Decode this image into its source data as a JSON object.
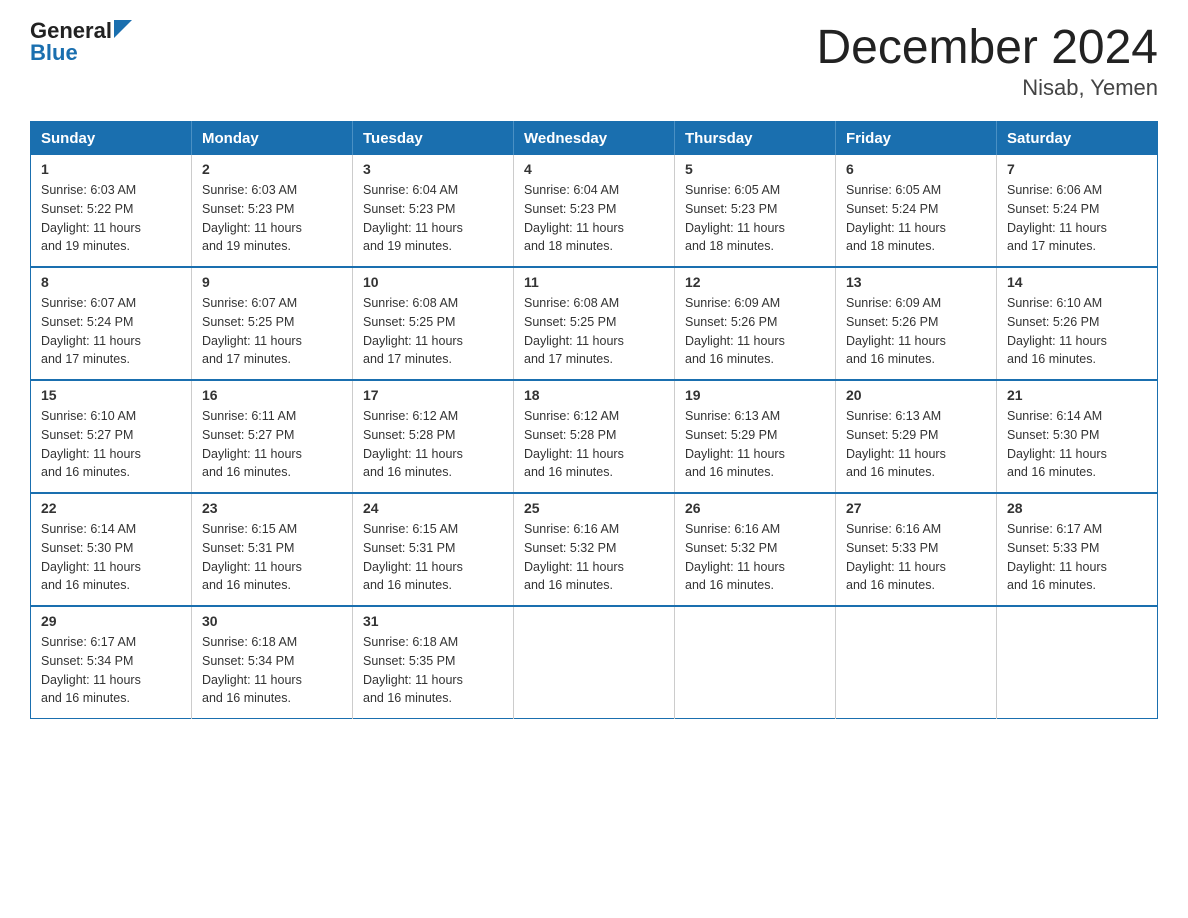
{
  "header": {
    "logo_line1": "General",
    "logo_line2": "Blue",
    "title": "December 2024",
    "subtitle": "Nisab, Yemen"
  },
  "days_of_week": [
    "Sunday",
    "Monday",
    "Tuesday",
    "Wednesday",
    "Thursday",
    "Friday",
    "Saturday"
  ],
  "weeks": [
    [
      {
        "day": "1",
        "sunrise": "6:03 AM",
        "sunset": "5:22 PM",
        "daylight": "11 hours and 19 minutes."
      },
      {
        "day": "2",
        "sunrise": "6:03 AM",
        "sunset": "5:23 PM",
        "daylight": "11 hours and 19 minutes."
      },
      {
        "day": "3",
        "sunrise": "6:04 AM",
        "sunset": "5:23 PM",
        "daylight": "11 hours and 19 minutes."
      },
      {
        "day": "4",
        "sunrise": "6:04 AM",
        "sunset": "5:23 PM",
        "daylight": "11 hours and 18 minutes."
      },
      {
        "day": "5",
        "sunrise": "6:05 AM",
        "sunset": "5:23 PM",
        "daylight": "11 hours and 18 minutes."
      },
      {
        "day": "6",
        "sunrise": "6:05 AM",
        "sunset": "5:24 PM",
        "daylight": "11 hours and 18 minutes."
      },
      {
        "day": "7",
        "sunrise": "6:06 AM",
        "sunset": "5:24 PM",
        "daylight": "11 hours and 17 minutes."
      }
    ],
    [
      {
        "day": "8",
        "sunrise": "6:07 AM",
        "sunset": "5:24 PM",
        "daylight": "11 hours and 17 minutes."
      },
      {
        "day": "9",
        "sunrise": "6:07 AM",
        "sunset": "5:25 PM",
        "daylight": "11 hours and 17 minutes."
      },
      {
        "day": "10",
        "sunrise": "6:08 AM",
        "sunset": "5:25 PM",
        "daylight": "11 hours and 17 minutes."
      },
      {
        "day": "11",
        "sunrise": "6:08 AM",
        "sunset": "5:25 PM",
        "daylight": "11 hours and 17 minutes."
      },
      {
        "day": "12",
        "sunrise": "6:09 AM",
        "sunset": "5:26 PM",
        "daylight": "11 hours and 16 minutes."
      },
      {
        "day": "13",
        "sunrise": "6:09 AM",
        "sunset": "5:26 PM",
        "daylight": "11 hours and 16 minutes."
      },
      {
        "day": "14",
        "sunrise": "6:10 AM",
        "sunset": "5:26 PM",
        "daylight": "11 hours and 16 minutes."
      }
    ],
    [
      {
        "day": "15",
        "sunrise": "6:10 AM",
        "sunset": "5:27 PM",
        "daylight": "11 hours and 16 minutes."
      },
      {
        "day": "16",
        "sunrise": "6:11 AM",
        "sunset": "5:27 PM",
        "daylight": "11 hours and 16 minutes."
      },
      {
        "day": "17",
        "sunrise": "6:12 AM",
        "sunset": "5:28 PM",
        "daylight": "11 hours and 16 minutes."
      },
      {
        "day": "18",
        "sunrise": "6:12 AM",
        "sunset": "5:28 PM",
        "daylight": "11 hours and 16 minutes."
      },
      {
        "day": "19",
        "sunrise": "6:13 AM",
        "sunset": "5:29 PM",
        "daylight": "11 hours and 16 minutes."
      },
      {
        "day": "20",
        "sunrise": "6:13 AM",
        "sunset": "5:29 PM",
        "daylight": "11 hours and 16 minutes."
      },
      {
        "day": "21",
        "sunrise": "6:14 AM",
        "sunset": "5:30 PM",
        "daylight": "11 hours and 16 minutes."
      }
    ],
    [
      {
        "day": "22",
        "sunrise": "6:14 AM",
        "sunset": "5:30 PM",
        "daylight": "11 hours and 16 minutes."
      },
      {
        "day": "23",
        "sunrise": "6:15 AM",
        "sunset": "5:31 PM",
        "daylight": "11 hours and 16 minutes."
      },
      {
        "day": "24",
        "sunrise": "6:15 AM",
        "sunset": "5:31 PM",
        "daylight": "11 hours and 16 minutes."
      },
      {
        "day": "25",
        "sunrise": "6:16 AM",
        "sunset": "5:32 PM",
        "daylight": "11 hours and 16 minutes."
      },
      {
        "day": "26",
        "sunrise": "6:16 AM",
        "sunset": "5:32 PM",
        "daylight": "11 hours and 16 minutes."
      },
      {
        "day": "27",
        "sunrise": "6:16 AM",
        "sunset": "5:33 PM",
        "daylight": "11 hours and 16 minutes."
      },
      {
        "day": "28",
        "sunrise": "6:17 AM",
        "sunset": "5:33 PM",
        "daylight": "11 hours and 16 minutes."
      }
    ],
    [
      {
        "day": "29",
        "sunrise": "6:17 AM",
        "sunset": "5:34 PM",
        "daylight": "11 hours and 16 minutes."
      },
      {
        "day": "30",
        "sunrise": "6:18 AM",
        "sunset": "5:34 PM",
        "daylight": "11 hours and 16 minutes."
      },
      {
        "day": "31",
        "sunrise": "6:18 AM",
        "sunset": "5:35 PM",
        "daylight": "11 hours and 16 minutes."
      },
      null,
      null,
      null,
      null
    ]
  ],
  "labels": {
    "sunrise": "Sunrise:",
    "sunset": "Sunset:",
    "daylight": "Daylight:"
  }
}
